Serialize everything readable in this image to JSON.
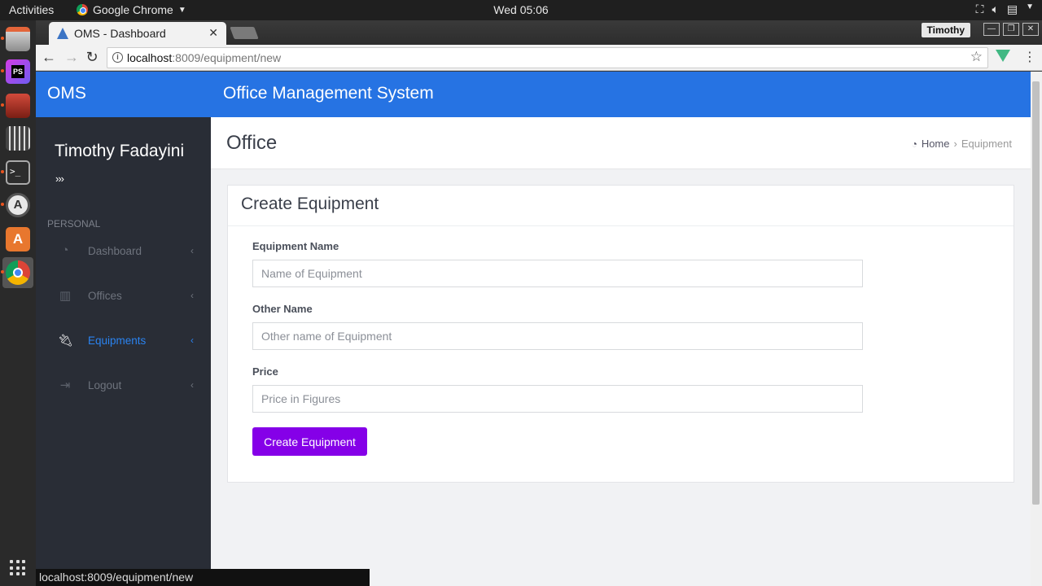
{
  "desktop": {
    "activities_label": "Activities",
    "app_name": "Google Chrome",
    "clock": "Wed 05:06",
    "tray_icons": [
      "network-icon",
      "volume-icon",
      "clipboard-icon",
      "system-menu-icon"
    ]
  },
  "dock": {
    "items": [
      "files-icon",
      "phpstorm-icon",
      "installer-icon",
      "video-editor-icon",
      "terminal-icon",
      "software-updater-icon",
      "software-center-icon",
      "chrome-icon"
    ],
    "show_apps_icon": "grid-icon"
  },
  "browser": {
    "tab_title": "OMS - Dashboard",
    "profile_name": "Timothy",
    "url_host": "localhost",
    "url_path": ":8009/equipment/new",
    "status_url": "localhost:8009/equipment/new"
  },
  "app": {
    "brand": "OMS",
    "title": "Office Management System"
  },
  "sidebar": {
    "user_name": "Timothy Fadayini",
    "expander": "›››",
    "section_label": "PERSONAL",
    "items": [
      {
        "label": "Dashboard",
        "icon": "dashboard-icon"
      },
      {
        "label": "Offices",
        "icon": "building-icon"
      },
      {
        "label": "Equipments",
        "icon": "plug-icon",
        "active": true
      },
      {
        "label": "Logout",
        "icon": "logout-icon"
      }
    ]
  },
  "page": {
    "title": "Office",
    "breadcrumb": {
      "home": "Home",
      "current": "Equipment"
    }
  },
  "form": {
    "title": "Create Equipment",
    "fields": [
      {
        "label": "Equipment Name",
        "placeholder": "Name of Equipment",
        "value": ""
      },
      {
        "label": "Other Name",
        "placeholder": "Other name of Equipment",
        "value": ""
      },
      {
        "label": "Price",
        "placeholder": "Price in Figures",
        "value": ""
      }
    ],
    "submit_label": "Create Equipment"
  },
  "colors": {
    "header": "#2673e3",
    "sidebar": "#292d36",
    "active_link": "#2a83f0",
    "submit_button": "#8500e8"
  }
}
